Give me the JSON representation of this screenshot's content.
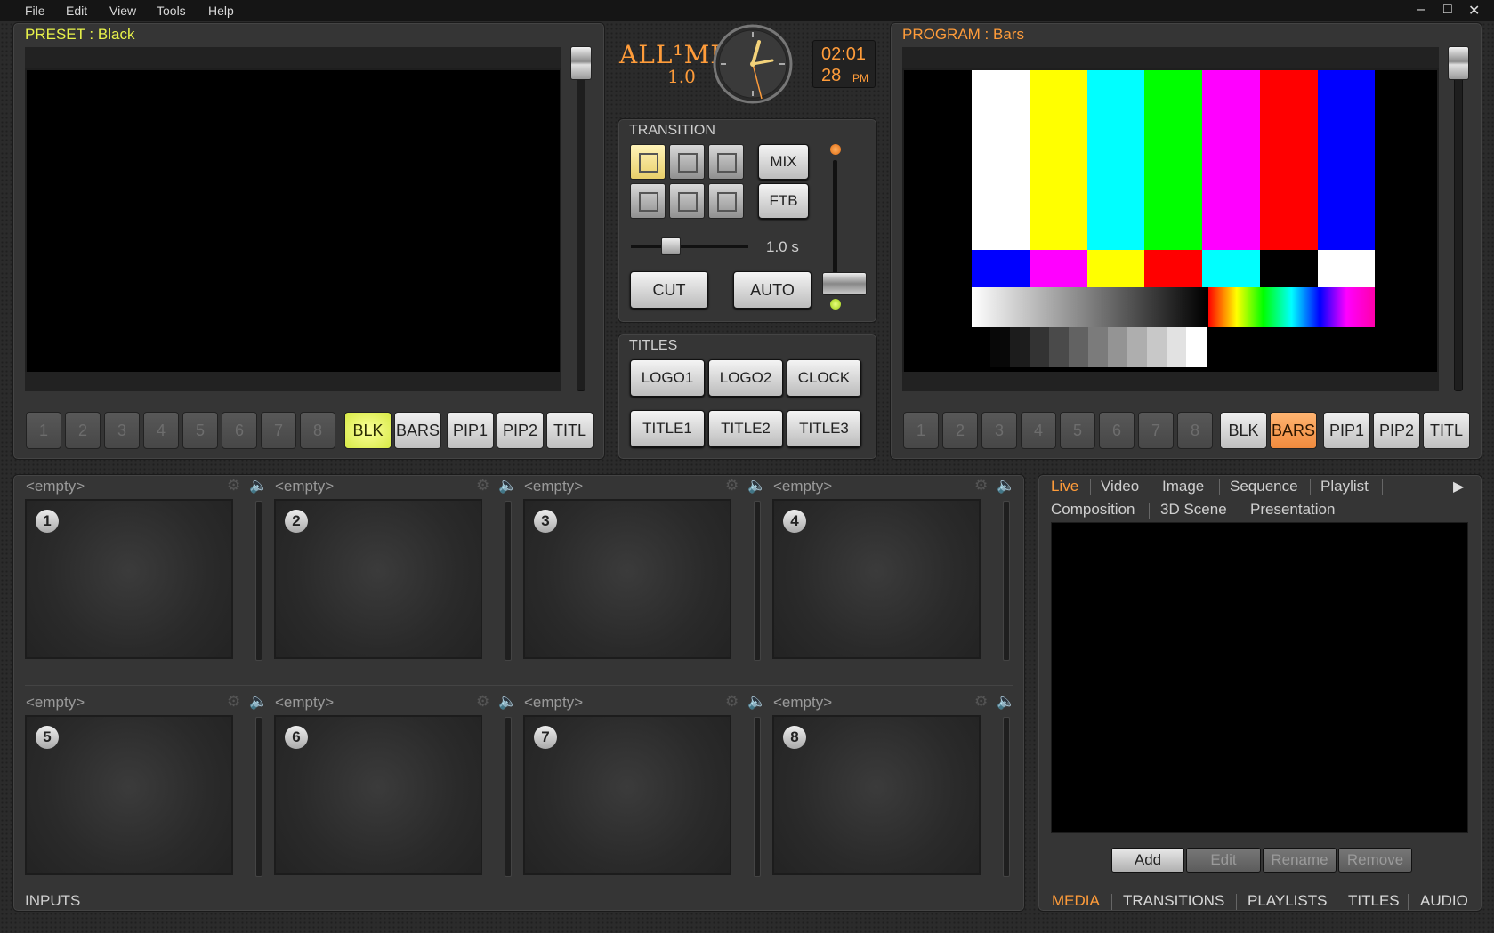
{
  "menu": [
    "File",
    "Edit",
    "View",
    "Tools",
    "Help"
  ],
  "window_controls": {
    "minimize": "–",
    "maximize": "□",
    "close": "✕"
  },
  "preset": {
    "title": "PRESET : Black"
  },
  "program": {
    "title": "PROGRAM : Bars"
  },
  "logo": {
    "name": "ALL¹MIX",
    "version": "1.0"
  },
  "clock": {
    "time": "02:01",
    "seconds": "28",
    "ampm": "PM"
  },
  "transition": {
    "header": "TRANSITION",
    "mix": "MIX",
    "ftb": "FTB",
    "duration": "1.0 s",
    "cut": "CUT",
    "auto": "AUTO"
  },
  "titles": {
    "header": "TITLES",
    "buttons": [
      "LOGO1",
      "LOGO2",
      "CLOCK",
      "TITLE1",
      "TITLE2",
      "TITLE3"
    ]
  },
  "source_buttons": {
    "numbers": [
      "1",
      "2",
      "3",
      "4",
      "5",
      "6",
      "7",
      "8"
    ],
    "labels": [
      "BLK",
      "BARS",
      "PIP1",
      "PIP2",
      "TITL"
    ],
    "preset_active": "BLK",
    "program_active": "BARS"
  },
  "inputs": {
    "footer": "INPUTS",
    "cells": [
      {
        "label": "<empty>",
        "num": "1"
      },
      {
        "label": "<empty>",
        "num": "2"
      },
      {
        "label": "<empty>",
        "num": "3"
      },
      {
        "label": "<empty>",
        "num": "4"
      },
      {
        "label": "<empty>",
        "num": "5"
      },
      {
        "label": "<empty>",
        "num": "6"
      },
      {
        "label": "<empty>",
        "num": "7"
      },
      {
        "label": "<empty>",
        "num": "8"
      }
    ]
  },
  "media": {
    "tabs_row1": [
      "Live",
      "Video",
      "Image",
      "Sequence",
      "Playlist"
    ],
    "tabs_row2": [
      "Composition",
      "3D Scene",
      "Presentation"
    ],
    "active_tab": "Live",
    "buttons": [
      "Add",
      "Edit",
      "Rename",
      "Remove"
    ],
    "bottom_tabs": [
      "MEDIA",
      "TRANSITIONS",
      "PLAYLISTS",
      "TITLES",
      "AUDIO"
    ],
    "bottom_active": "MEDIA"
  },
  "colors": {
    "accent_orange": "#ff9c3a",
    "preset_title": "#e8f24a",
    "program_title": "#ff9c3a"
  }
}
